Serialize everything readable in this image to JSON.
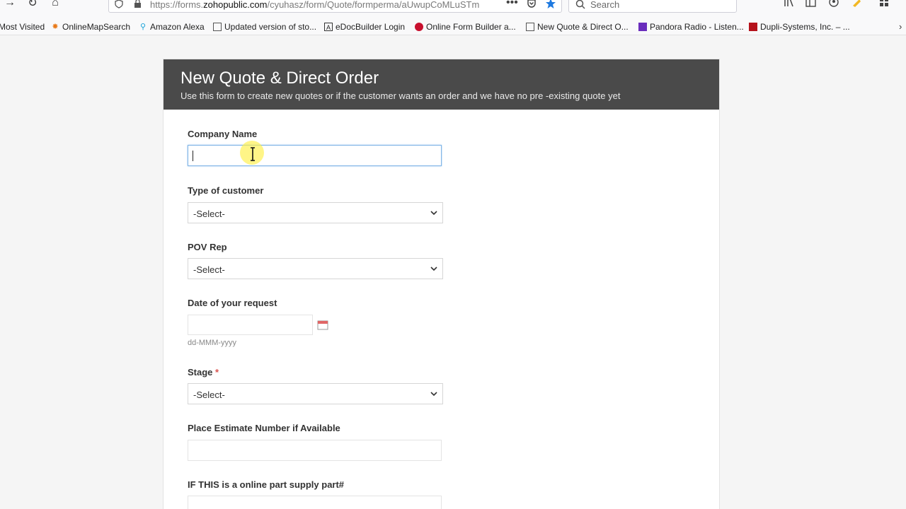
{
  "browser": {
    "url_prefix": "https://forms.",
    "url_domain": "zohopublic.com",
    "url_rest": "/cyuhasz/form/Quote/formperma/aUwupCoMLuSTm",
    "search_placeholder": "Search"
  },
  "bookmarks": [
    {
      "label": "Most Visited",
      "icon": "gear-icon"
    },
    {
      "label": "OnlineMapSearch",
      "icon": "star-icon"
    },
    {
      "label": "Amazon Alexa",
      "icon": "location-pin-icon"
    },
    {
      "label": "Updated version of sto...",
      "icon": "page-icon"
    },
    {
      "label": "eDocBuilder Login",
      "icon": "doc-builder-icon"
    },
    {
      "label": "Online Form Builder a...",
      "icon": "wufoo-icon"
    },
    {
      "label": "New Quote & Direct O...",
      "icon": "page-icon"
    },
    {
      "label": "Pandora Radio - Listen...",
      "icon": "pandora-icon"
    },
    {
      "label": "Dupli-Systems, Inc. – ...",
      "icon": "dupli-icon"
    }
  ],
  "form": {
    "title": "New Quote & Direct Order",
    "description": "Use this form to create new quotes or if the customer wants an order and we have no pre -existing quote yet",
    "fields": {
      "company_name": {
        "label": "Company Name",
        "value": ""
      },
      "customer_type": {
        "label": "Type of customer",
        "value": "-Select-"
      },
      "pov_rep": {
        "label": "POV Rep",
        "value": "-Select-"
      },
      "date": {
        "label": "Date of your request",
        "value": "",
        "hint": "dd-MMM-yyyy"
      },
      "stage": {
        "label": "Stage",
        "required_mark": "*",
        "value": "-Select-"
      },
      "estimate": {
        "label": "Place Estimate Number if Available",
        "value": ""
      },
      "part_supply": {
        "label": "IF THIS is a online part supply part#",
        "value": ""
      }
    }
  },
  "colors": {
    "header_bg": "#4a4a4a",
    "required": "#d9534f",
    "focus": "#7fb4e6"
  }
}
